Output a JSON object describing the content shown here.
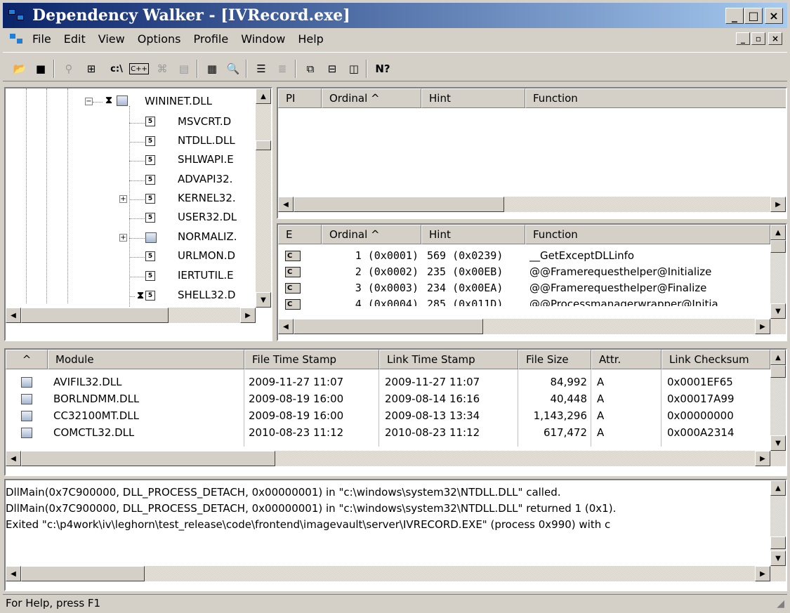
{
  "window": {
    "app": "Dependency Walker",
    "title": "Dependency Walker - [IVRecord.exe]",
    "minimize": "_",
    "maximize": "□",
    "close": "×"
  },
  "menu": {
    "items": [
      "File",
      "Edit",
      "View",
      "Options",
      "Profile",
      "Window",
      "Help"
    ],
    "accel": [
      "F",
      "E",
      "V",
      "O",
      "P",
      "W",
      "H"
    ]
  },
  "mdi": {
    "minimize": "_",
    "restore": "▫",
    "close": "×"
  },
  "toolbar": {
    "icons": [
      "open-icon",
      "save-icon",
      "find-icon",
      "tree-icon",
      "path-icon",
      "cpp-icon",
      "profile-icon",
      "properties-icon",
      "system-icon",
      "find-next-icon",
      "sort-icon",
      "import-icon",
      "tile-icon",
      "split-h-icon",
      "split-v-icon",
      "help-icon"
    ],
    "path_label": "c:\\",
    "cpp_label": "C++",
    "help_label": "N?"
  },
  "tree": {
    "items": [
      {
        "label": "WININET.DLL",
        "level": 0
      },
      {
        "label": "MSVCRT.D",
        "level": 1
      },
      {
        "label": "NTDLL.DLL",
        "level": 1
      },
      {
        "label": "SHLWAPI.E",
        "level": 1
      },
      {
        "label": "ADVAPI32.",
        "level": 1
      },
      {
        "label": "KERNEL32.",
        "level": 1
      },
      {
        "label": "USER32.DL",
        "level": 1
      },
      {
        "label": "NORMALIZ.",
        "level": 1
      },
      {
        "label": "URLMON.D",
        "level": 1
      },
      {
        "label": "IERTUTIL.E",
        "level": 1
      },
      {
        "label": "SHELL32.D",
        "level": 1
      }
    ]
  },
  "imports": {
    "columns": [
      "PI",
      "Ordinal ^",
      "Hint",
      "Function"
    ]
  },
  "exports": {
    "columns": [
      "E",
      "Ordinal ^",
      "Hint",
      "Function"
    ],
    "rows": [
      {
        "e": "C",
        "ordinal": "1 (0x0001)",
        "hint": "569 (0x0239)",
        "function": "__GetExceptDLLinfo"
      },
      {
        "e": "C",
        "ordinal": "2 (0x0002)",
        "hint": "235 (0x00EB)",
        "function": "@@Framerequesthelper@Initialize"
      },
      {
        "e": "C",
        "ordinal": "3 (0x0003)",
        "hint": "234 (0x00EA)",
        "function": "@@Framerequesthelper@Finalize"
      },
      {
        "e": "C",
        "ordinal": "4 (0x0004)",
        "hint": "285 (0x011D)",
        "function": "@@Processmanagerwrapper@Initia"
      }
    ]
  },
  "modules": {
    "columns": [
      "^",
      "Module",
      "File Time Stamp",
      "Link Time Stamp",
      "File Size",
      "Attr.",
      "Link Checksum"
    ],
    "rows": [
      {
        "module": "AVIFIL32.DLL",
        "file_ts": "2009-11-27 11:07",
        "link_ts": "2009-11-27 11:07",
        "size": "84,992",
        "attr": "A",
        "checksum": "0x0001EF65"
      },
      {
        "module": "BORLNDMM.DLL",
        "file_ts": "2009-08-19 16:00",
        "link_ts": "2009-08-14 16:16",
        "size": "40,448",
        "attr": "A",
        "checksum": "0x00017A99"
      },
      {
        "module": "CC32100MT.DLL",
        "file_ts": "2009-08-19 16:00",
        "link_ts": "2009-08-13 13:34",
        "size": "1,143,296",
        "attr": "A",
        "checksum": "0x00000000"
      },
      {
        "module": "COMCTL32.DLL",
        "file_ts": "2010-08-23 11:12",
        "link_ts": "2010-08-23 11:12",
        "size": "617,472",
        "attr": "A",
        "checksum": "0x000A2314"
      }
    ]
  },
  "log": {
    "lines": [
      "DllMain(0x7C900000, DLL_PROCESS_DETACH, 0x00000001) in \"c:\\windows\\system32\\NTDLL.DLL\" called.",
      "DllMain(0x7C900000, DLL_PROCESS_DETACH, 0x00000001) in \"c:\\windows\\system32\\NTDLL.DLL\" returned 1 (0x1).",
      "Exited \"c:\\p4work\\iv\\leghorn\\test_release\\code\\frontend\\imagevault\\server\\IVRECORD.EXE\" (process 0x990) with c"
    ]
  },
  "status": {
    "text": "For Help, press F1"
  },
  "colors": {
    "titlebar_start": "#0a246a",
    "titlebar_end": "#a6caf0",
    "face": "#d4d0c8"
  }
}
